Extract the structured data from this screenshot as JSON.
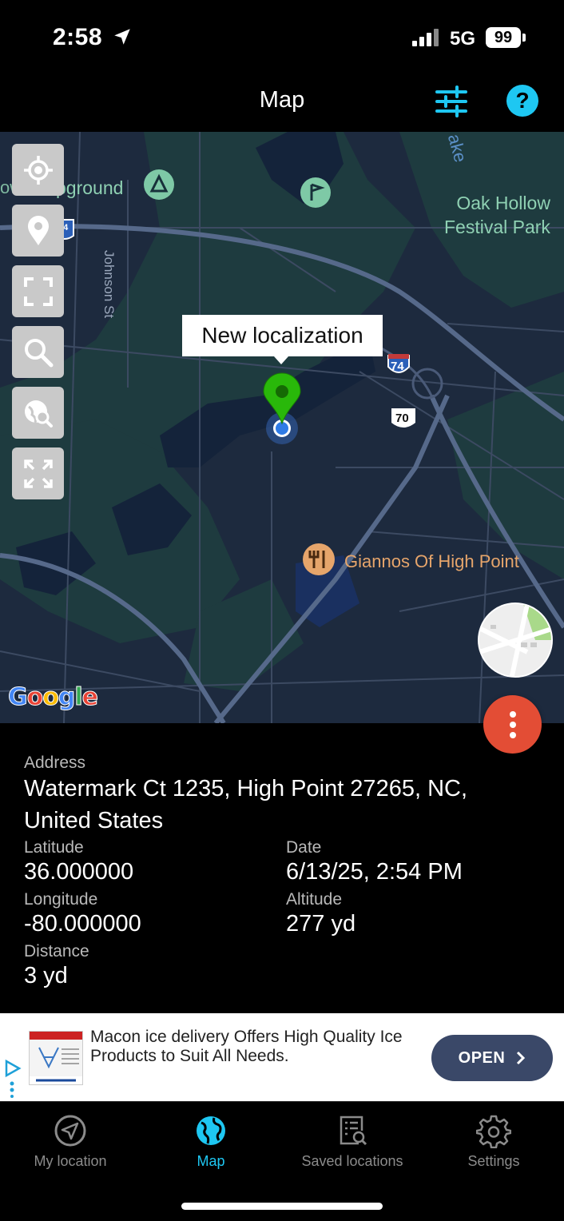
{
  "status_bar": {
    "time": "2:58",
    "network": "5G",
    "battery": "99"
  },
  "header": {
    "title": "Map",
    "filter_icon": "sliders-icon",
    "help_label": "?"
  },
  "map": {
    "labels": {
      "campground": "pground",
      "campground_prefix": "ow",
      "park": "Oak Hollow\nFestival Park",
      "street": "Johnson St",
      "lake": "ake",
      "restaurant": "Giannos Of High Point",
      "route_74": "74",
      "route_70": "70",
      "route_74b": "74"
    },
    "callout": "New localization",
    "tools": [
      {
        "name": "my-location-tool",
        "icon": "crosshair-icon"
      },
      {
        "name": "pin-tool",
        "icon": "map-pin-icon"
      },
      {
        "name": "frame-tool",
        "icon": "frame-corners-icon"
      },
      {
        "name": "search-tool",
        "icon": "search-icon"
      },
      {
        "name": "globe-search-tool",
        "icon": "globe-search-icon"
      },
      {
        "name": "expand-tool",
        "icon": "expand-arrows-icon"
      }
    ],
    "google_logo": "Google",
    "accent_color": "#1ec7f2",
    "pin_color": "#29b80a",
    "fab_color": "#e34d35"
  },
  "info": {
    "address_label": "Address",
    "address_value": "Watermark Ct 1235, High Point 27265, NC, United States",
    "latitude_label": "Latitude",
    "latitude_value": "36.000000",
    "date_label": "Date",
    "date_value": "6/13/25, 2:54 PM",
    "longitude_label": "Longitude",
    "longitude_value": "-80.000000",
    "altitude_label": "Altitude",
    "altitude_value": "277 yd",
    "distance_label": "Distance",
    "distance_value": "3 yd"
  },
  "ad": {
    "text": "Macon ice delivery Offers High Quality Ice Products to Suit All Needs.",
    "button": "OPEN"
  },
  "tabs": [
    {
      "label": "My location",
      "icon": "navigation-arrow-icon",
      "active": false
    },
    {
      "label": "Map",
      "icon": "globe-icon",
      "active": true
    },
    {
      "label": "Saved locations",
      "icon": "saved-list-icon",
      "active": false
    },
    {
      "label": "Settings",
      "icon": "gear-icon",
      "active": false
    }
  ]
}
